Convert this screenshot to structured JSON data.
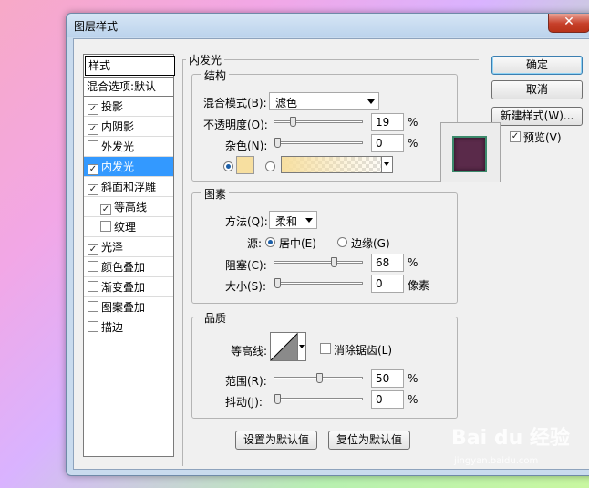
{
  "window": {
    "title": "图层样式",
    "close": "✕"
  },
  "style_list": {
    "header": "样式",
    "blend_options": "混合选项:默认",
    "items": [
      {
        "label": "投影",
        "checked": true
      },
      {
        "label": "内阴影",
        "checked": true
      },
      {
        "label": "外发光",
        "checked": false
      },
      {
        "label": "内发光",
        "checked": true,
        "selected": true
      },
      {
        "label": "斜面和浮雕",
        "checked": true
      },
      {
        "label": "等高线",
        "checked": true,
        "sub": true
      },
      {
        "label": "纹理",
        "checked": false,
        "sub": true
      },
      {
        "label": "光泽",
        "checked": true
      },
      {
        "label": "颜色叠加",
        "checked": false
      },
      {
        "label": "渐变叠加",
        "checked": false
      },
      {
        "label": "图案叠加",
        "checked": false
      },
      {
        "label": "描边",
        "checked": false
      }
    ]
  },
  "panel": {
    "title": "内发光",
    "structure": {
      "title": "结构",
      "blend_mode_label": "混合模式(B):",
      "blend_mode_value": "滤色",
      "opacity_label": "不透明度(O):",
      "opacity_value": "19",
      "noise_label": "杂色(N):",
      "noise_value": "0",
      "percent": "%",
      "color_swatch": "#f7dfa0"
    },
    "elements": {
      "title": "图素",
      "method_label": "方法(Q):",
      "method_value": "柔和",
      "source_label": "源:",
      "source_center": "居中(E)",
      "source_edge": "边缘(G)",
      "choke_label": "阻塞(C):",
      "choke_value": "68",
      "size_label": "大小(S):",
      "size_value": "0",
      "size_unit": "像素",
      "percent": "%"
    },
    "quality": {
      "title": "品质",
      "contour_label": "等高线:",
      "anti_alias_label": "消除锯齿(L)",
      "range_label": "范围(R):",
      "range_value": "50",
      "jitter_label": "抖动(J):",
      "jitter_value": "0",
      "percent": "%"
    },
    "set_default": "设置为默认值",
    "reset_default": "复位为默认值"
  },
  "right": {
    "ok": "确定",
    "cancel": "取消",
    "new_style": "新建样式(W)...",
    "preview_label": "预览(V)",
    "preview_checked": true
  },
  "sliders": {
    "opacity": 19,
    "noise": 0,
    "choke": 68,
    "size": 0,
    "range": 50,
    "jitter": 0
  },
  "watermark": {
    "brand": "Bai du 经验",
    "url": "jingyan.baidu.com"
  }
}
